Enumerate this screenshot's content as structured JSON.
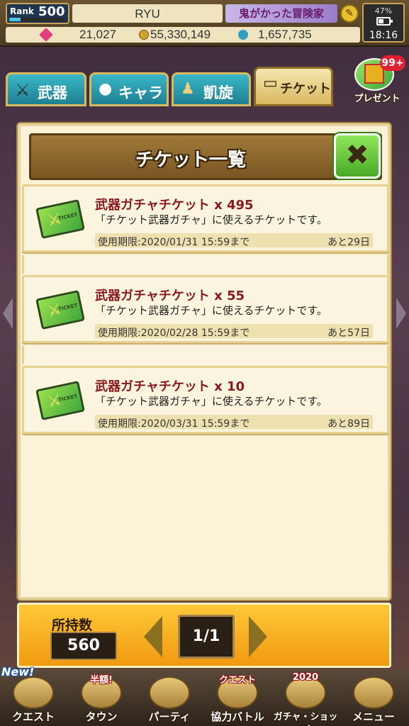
{
  "header": {
    "rank_label": "Rank",
    "rank_value": "500",
    "player_name": "RYU",
    "game_title": "鬼がかった冒険家",
    "gems": "21,027",
    "gold": "55,330,149",
    "points": "1,657,735",
    "battery_percent": "47%",
    "battery_level": 0.47,
    "time": "18:16"
  },
  "tabs": [
    {
      "label": "武器",
      "icon": "sword-icon"
    },
    {
      "label": "キャラ",
      "icon": "character-icon"
    },
    {
      "label": "凱旋",
      "icon": "hero-icon"
    },
    {
      "label": "チケット",
      "icon": "ticket-icon"
    }
  ],
  "present": {
    "label": "プレゼント",
    "badge": "99+"
  },
  "dialog": {
    "title": "チケット一覧",
    "close_icon": "close-x-icon",
    "tickets": [
      {
        "name": "武器ガチャチケット x 495",
        "description": "「チケット武器ガチャ」に使えるチケットです。",
        "expiry": "使用期限:2020/01/31 15:59まで",
        "remaining": "あと29日"
      },
      {
        "name": "武器ガチャチケット x 55",
        "description": "「チケット武器ガチャ」に使えるチケットです。",
        "expiry": "使用期限:2020/02/28 15:59まで",
        "remaining": "あと57日"
      },
      {
        "name": "武器ガチャチケット x 10",
        "description": "「チケット武器ガチャ」に使えるチケットです。",
        "expiry": "使用期限:2020/03/31 15:59まで",
        "remaining": "あと89日"
      }
    ]
  },
  "footer": {
    "owned_label": "所持数",
    "owned_value": "560",
    "page": "1/1"
  },
  "bottom_nav": {
    "new_tag": "New!",
    "items": [
      {
        "label": "クエスト",
        "tag": ""
      },
      {
        "label": "タウン",
        "tag": "半額!"
      },
      {
        "label": "パーティ",
        "tag": ""
      },
      {
        "label": "協力バトル",
        "tag": "クエスト"
      },
      {
        "label": "ガチャ・ショップ",
        "tag": "2020"
      },
      {
        "label": "メニュー",
        "tag": ""
      }
    ]
  },
  "colors": {
    "ticket_name": "#8a1a1a",
    "footer_bar": "#f5a820",
    "close_button": "#6cc840",
    "dialog_header": "#8a6430"
  }
}
